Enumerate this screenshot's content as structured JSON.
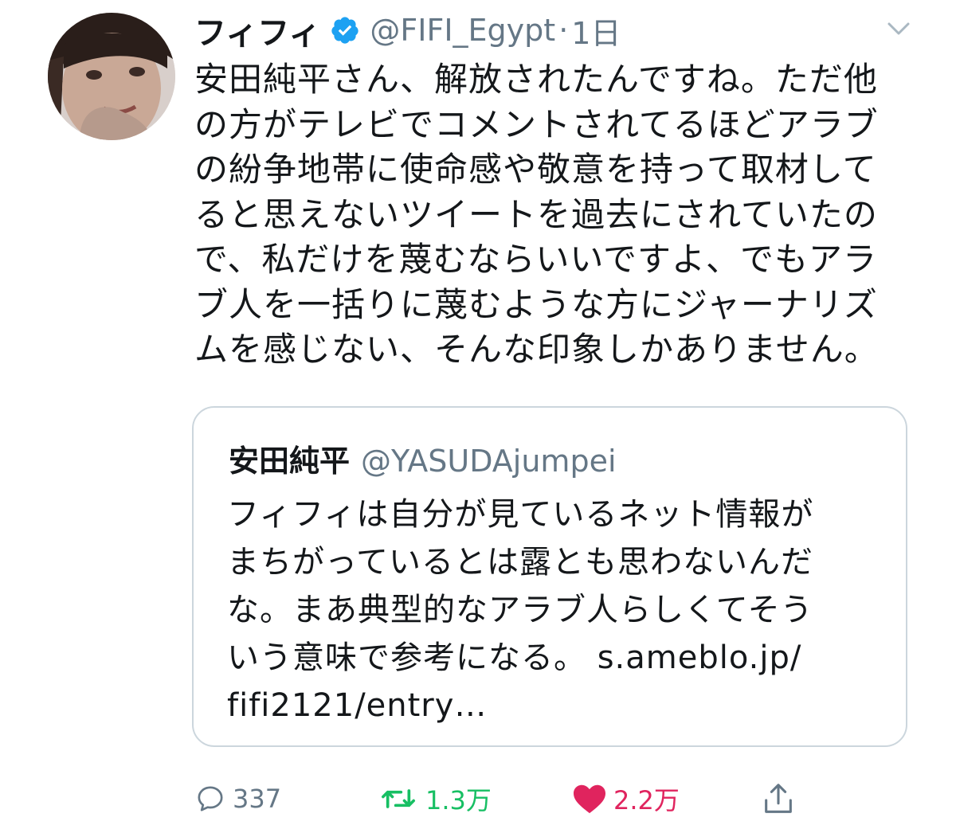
{
  "tweet": {
    "display_name": "フィフィ",
    "handle": "@FIFI_Egypt",
    "separator": "·",
    "time": "1日",
    "verified_icon": "verified-badge-icon",
    "text": "安田純平さん、解放されたんですね。ただ他\nの方がテレビでコメントされてるほどアラブ\nの紛争地帯に使命感や敬意を持って取材して\nると思えないツイートを過去にされていたの\nで、私だけを蔑むならいいですよ、でもアラ\nブ人を一括りに蔑むような方にジャーナリズ\nムを感じない、そんな印象しかありません。"
  },
  "quoted_tweet": {
    "display_name": "安田純平",
    "handle": "@YASUDAjumpei",
    "text": "フィフィは自分が見ているネット情報が\nまちがっているとは露とも思わないんだ\nな。まあ典型的なアラブ人らしくてそう\nいう意味で参考になる。 s.ameblo.jp/\nfifi2121/entry…"
  },
  "actions": {
    "reply_count": "337",
    "retweet_count": "1.3万",
    "like_count": "2.2万"
  },
  "colors": {
    "verified": "#1da1f2",
    "secondary_text": "#657786",
    "retweet_active": "#17bf63",
    "like_active": "#e0245e",
    "quote_border": "#ccd6dd"
  }
}
